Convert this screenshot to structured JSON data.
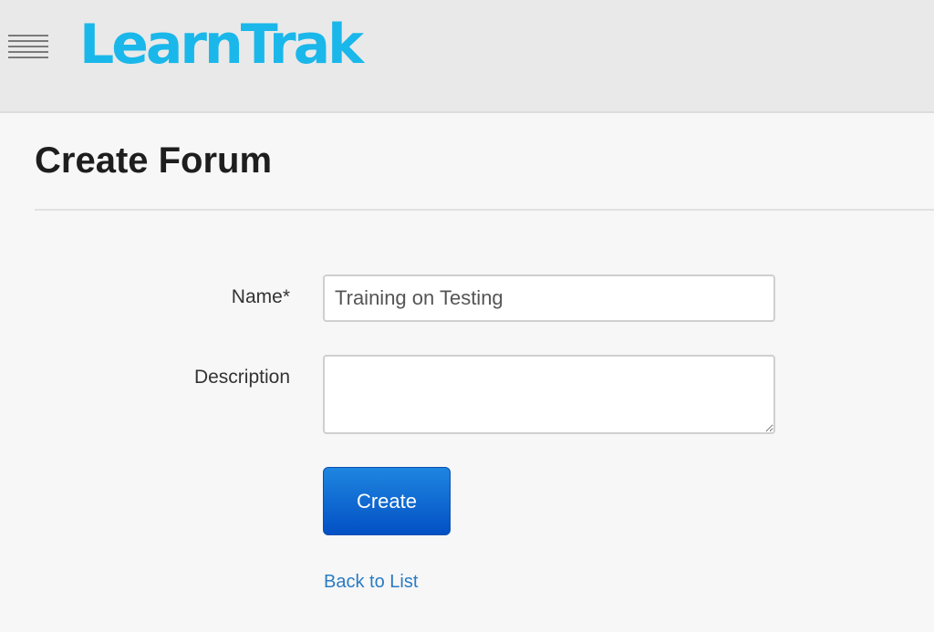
{
  "header": {
    "menu_icon": "hamburger-menu-icon",
    "logo_text": "LearnTrak",
    "logo_color": "#1ab7ea"
  },
  "page": {
    "title": "Create Forum"
  },
  "form": {
    "name_label": "Name*",
    "name_value": "Training on Testing",
    "description_label": "Description",
    "description_value": "",
    "create_label": "Create",
    "back_link": "Back to List"
  },
  "colors": {
    "primary_button": "#0a5fd0",
    "link": "#2a7bc4"
  }
}
